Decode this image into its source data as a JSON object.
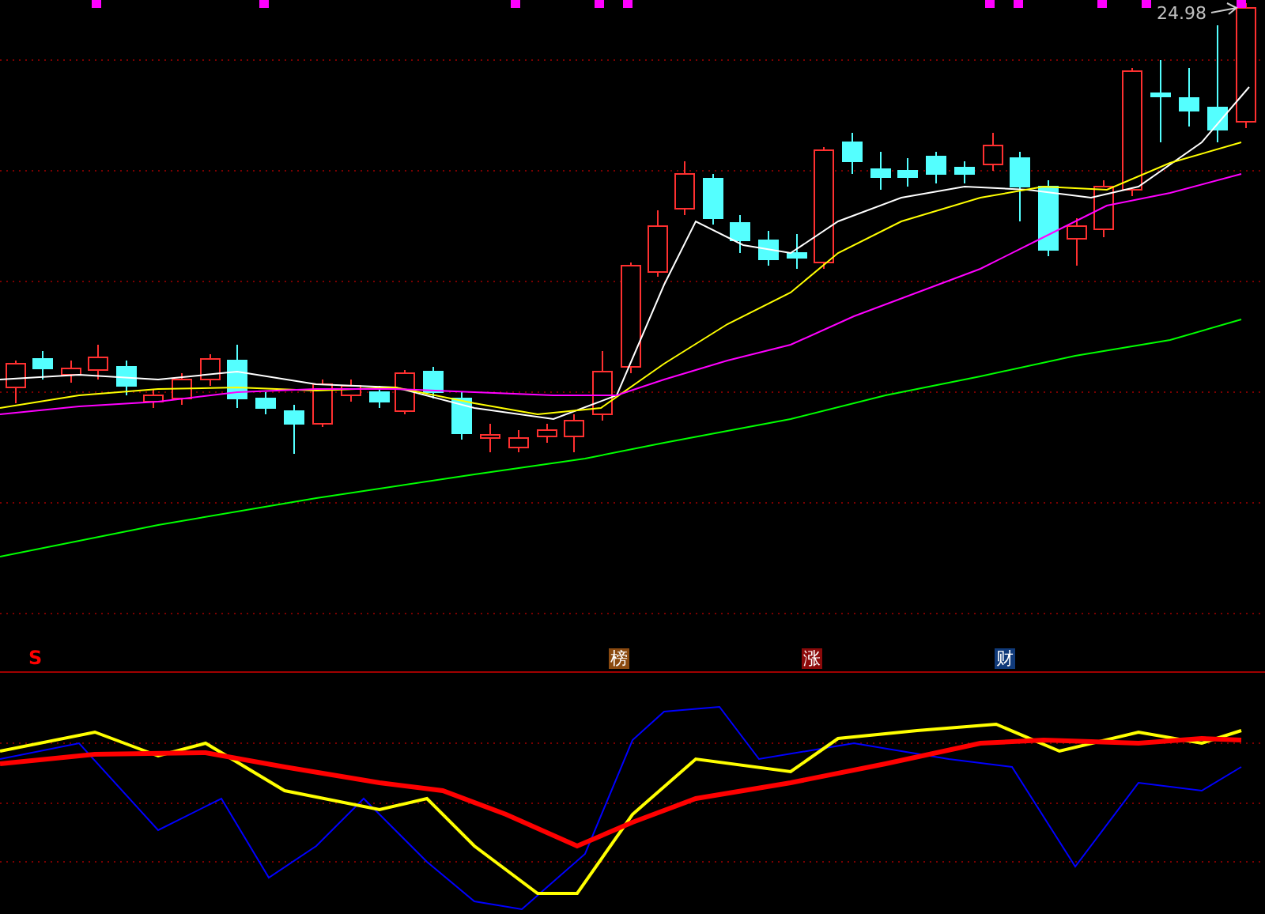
{
  "price_label": "24.98",
  "markers": [
    {
      "text": "S",
      "kind": "signal",
      "color": "#ff0000"
    },
    {
      "text": "榜",
      "kind": "badge",
      "color": "#8b4a10"
    },
    {
      "text": "涨",
      "kind": "badge",
      "color": "#8b0a0a"
    },
    {
      "text": "财",
      "kind": "badge",
      "color": "#103a7a"
    }
  ]
}
